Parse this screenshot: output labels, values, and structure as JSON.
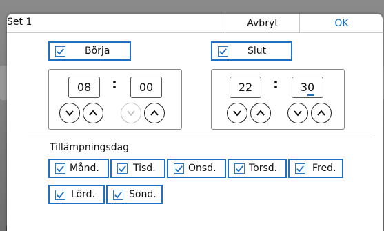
{
  "dialog": {
    "title": "Set 1",
    "cancel_label": "Avbryt",
    "ok_label": "OK"
  },
  "start": {
    "label": "Börja",
    "checked": true,
    "hour": "08",
    "minute": "00"
  },
  "end": {
    "label": "Slut",
    "checked": true,
    "hour": "22",
    "minute": "30"
  },
  "time_separator": ":",
  "days": {
    "label": "Tillämpningsdag",
    "items": [
      {
        "label": "Månd.",
        "checked": true
      },
      {
        "label": "Tisd.",
        "checked": true
      },
      {
        "label": "Onsd.",
        "checked": true
      },
      {
        "label": "Torsd.",
        "checked": true
      },
      {
        "label": "Fred.",
        "checked": true
      },
      {
        "label": "Lörd.",
        "checked": true
      },
      {
        "label": "Sönd.",
        "checked": true
      }
    ]
  },
  "colors": {
    "accent": "#1f6fc2",
    "ok_text": "#1673c6",
    "backdrop": "#7b7b7b"
  },
  "icons": {
    "checkbox": "checkmark-icon",
    "increment": "chevron-up-icon",
    "decrement": "chevron-down-icon"
  }
}
